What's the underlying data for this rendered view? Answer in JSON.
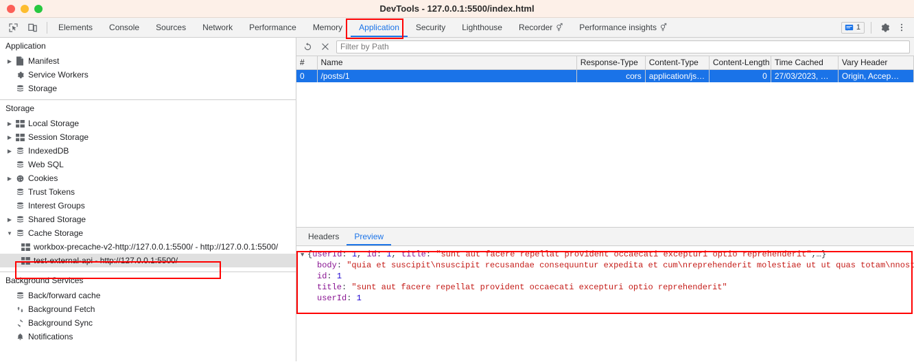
{
  "window": {
    "title": "DevTools - 127.0.0.1:5500/index.html",
    "traffic_lights": [
      "close-red",
      "minimize-yellow",
      "maximize-green"
    ]
  },
  "toolbar": {
    "inspect_icon": "inspect-element-icon",
    "device_icon": "device-toolbar-icon",
    "tabs": [
      {
        "label": "Elements",
        "active": false,
        "experimental": false
      },
      {
        "label": "Console",
        "active": false,
        "experimental": false
      },
      {
        "label": "Sources",
        "active": false,
        "experimental": false
      },
      {
        "label": "Network",
        "active": false,
        "experimental": false
      },
      {
        "label": "Performance",
        "active": false,
        "experimental": false
      },
      {
        "label": "Memory",
        "active": false,
        "experimental": false
      },
      {
        "label": "Application",
        "active": true,
        "experimental": false
      },
      {
        "label": "Security",
        "active": false,
        "experimental": false
      },
      {
        "label": "Lighthouse",
        "active": false,
        "experimental": false
      },
      {
        "label": "Recorder",
        "active": false,
        "experimental": true
      },
      {
        "label": "Performance insights",
        "active": false,
        "experimental": true
      }
    ],
    "issues_count": "1",
    "issues_icon": "issues-message-icon",
    "settings_icon": "gear-icon",
    "more_icon": "kebab-menu-icon",
    "accent_color": "#1a73e8"
  },
  "sidebar": {
    "sections": [
      {
        "title": "Application",
        "items": [
          {
            "label": "Manifest",
            "icon": "manifest-file-icon",
            "arrow": "collapsed",
            "indent": 0
          },
          {
            "label": "Service Workers",
            "icon": "gear-icon",
            "arrow": "none",
            "indent": 0
          },
          {
            "label": "Storage",
            "icon": "database-icon",
            "arrow": "none",
            "indent": 0
          }
        ]
      },
      {
        "title": "Storage",
        "items": [
          {
            "label": "Local Storage",
            "icon": "table-grid-icon",
            "arrow": "collapsed",
            "indent": 0
          },
          {
            "label": "Session Storage",
            "icon": "table-grid-icon",
            "arrow": "collapsed",
            "indent": 0
          },
          {
            "label": "IndexedDB",
            "icon": "database-icon",
            "arrow": "collapsed",
            "indent": 0
          },
          {
            "label": "Web SQL",
            "icon": "database-icon",
            "arrow": "none",
            "indent": 0
          },
          {
            "label": "Cookies",
            "icon": "cookie-icon",
            "arrow": "collapsed",
            "indent": 0
          },
          {
            "label": "Trust Tokens",
            "icon": "database-icon",
            "arrow": "none",
            "indent": 0
          },
          {
            "label": "Interest Groups",
            "icon": "database-icon",
            "arrow": "none",
            "indent": 0
          },
          {
            "label": "Shared Storage",
            "icon": "database-icon",
            "arrow": "collapsed",
            "indent": 0
          },
          {
            "label": "Cache Storage",
            "icon": "database-icon",
            "arrow": "expanded",
            "indent": 0
          },
          {
            "label": "workbox-precache-v2-http://127.0.0.1:5500/ - http://127.0.0.1:5500/",
            "icon": "table-grid-icon",
            "arrow": "none",
            "indent": 1
          },
          {
            "label": "test-external-api - http://127.0.0.1:5500/",
            "icon": "table-grid-icon",
            "arrow": "none",
            "indent": 1,
            "selected": true
          }
        ]
      },
      {
        "title": "Background Services",
        "items": [
          {
            "label": "Back/forward cache",
            "icon": "database-icon",
            "arrow": "none",
            "indent": 0
          },
          {
            "label": "Background Fetch",
            "icon": "fetch-arrows-icon",
            "arrow": "none",
            "indent": 0
          },
          {
            "label": "Background Sync",
            "icon": "sync-refresh-icon",
            "arrow": "none",
            "indent": 0
          },
          {
            "label": "Notifications",
            "icon": "bell-icon",
            "arrow": "none",
            "indent": 0
          }
        ]
      }
    ]
  },
  "cache_panel": {
    "refresh_icon": "refresh-icon",
    "delete_icon": "delete-x-icon",
    "filter_placeholder": "Filter by Path",
    "filter_value": "",
    "columns": [
      "#",
      "Name",
      "Response-Type",
      "Content-Type",
      "Content-Length",
      "Time Cached",
      "Vary Header"
    ],
    "rows": [
      {
        "index": "0",
        "name": "/posts/1",
        "response_type": "cors",
        "content_type": "application/js…",
        "content_length": "0",
        "time_cached": "27/03/2023, …",
        "vary_header": "Origin, Accep…",
        "selected": true
      }
    ]
  },
  "detail_panel": {
    "tabs": [
      {
        "label": "Headers",
        "active": false
      },
      {
        "label": "Preview",
        "active": true
      }
    ],
    "preview": {
      "root_line": {
        "prefix": "{",
        "parts": [
          {
            "text": "userId",
            "kind": "key"
          },
          {
            "text": ": ",
            "kind": "punct"
          },
          {
            "text": "1",
            "kind": "num"
          },
          {
            "text": ", ",
            "kind": "punct"
          },
          {
            "text": "id",
            "kind": "key"
          },
          {
            "text": ": ",
            "kind": "punct"
          },
          {
            "text": "1",
            "kind": "num"
          },
          {
            "text": ", ",
            "kind": "punct"
          },
          {
            "text": "title",
            "kind": "key"
          },
          {
            "text": ": ",
            "kind": "punct"
          },
          {
            "text": "\"sunt aut facere repellat provident occaecati excepturi optio reprehenderit\"",
            "kind": "str"
          },
          {
            "text": ",…}",
            "kind": "punct"
          }
        ]
      },
      "children": [
        {
          "key": "body",
          "value": "\"quia et suscipit\\nsuscipit recusandae consequuntur expedita et cum\\nreprehenderit molestiae ut ut quas totam\\nnostrum rerum e",
          "kind": "str"
        },
        {
          "key": "id",
          "value": "1",
          "kind": "num"
        },
        {
          "key": "title",
          "value": "\"sunt aut facere repellat provident occaecati excepturi optio reprehenderit\"",
          "kind": "str"
        },
        {
          "key": "userId",
          "value": "1",
          "kind": "num"
        }
      ]
    }
  },
  "annotations": {
    "color": "#ff0000",
    "boxes": [
      "application-tab-highlight",
      "cache-entry-highlight",
      "preview-body-highlight"
    ]
  }
}
